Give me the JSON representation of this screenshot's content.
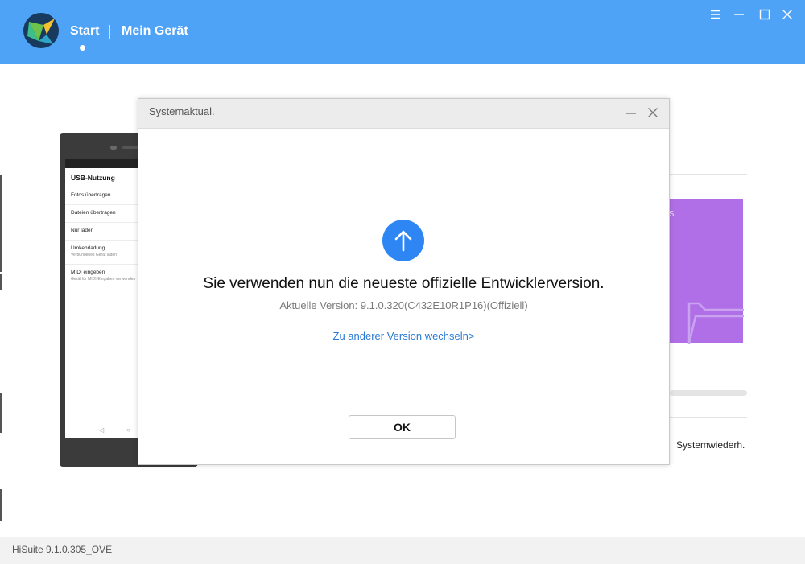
{
  "header": {
    "nav_start": "Start",
    "nav_device": "Mein Gerät",
    "icons": [
      "menu-icon",
      "minimize-icon",
      "maximize-icon",
      "close-icon"
    ],
    "accent_color": "#4ea3f7"
  },
  "phone": {
    "title": "USB-Nutzung",
    "items": [
      {
        "label": "Fotos übertragen",
        "sub": ""
      },
      {
        "label": "Dateien übertragen",
        "sub": ""
      },
      {
        "label": "Nur laden",
        "sub": ""
      },
      {
        "label": "Umkehrladung",
        "sub": "Verbundenes Gerät laden"
      },
      {
        "label": "MIDI eingeben",
        "sub": "Gerät für MIDI-Eingaben verwenden"
      }
    ]
  },
  "background": {
    "tile_letter": "s",
    "system_recovery": "Systemwiederh."
  },
  "dialog": {
    "title": "Systemaktual.",
    "message": "Sie verwenden nun die neueste offizielle Entwicklerversion.",
    "version": "Aktuelle Version: 9.1.0.320(C432E10R1P16)(Offiziell)",
    "switch_link": "Zu anderer Version wechseln>",
    "ok_label": "OK",
    "icon": "arrow-up-icon",
    "icon_color": "#2e86f5"
  },
  "footer": {
    "version_text": "HiSuite 9.1.0.305_OVE"
  }
}
